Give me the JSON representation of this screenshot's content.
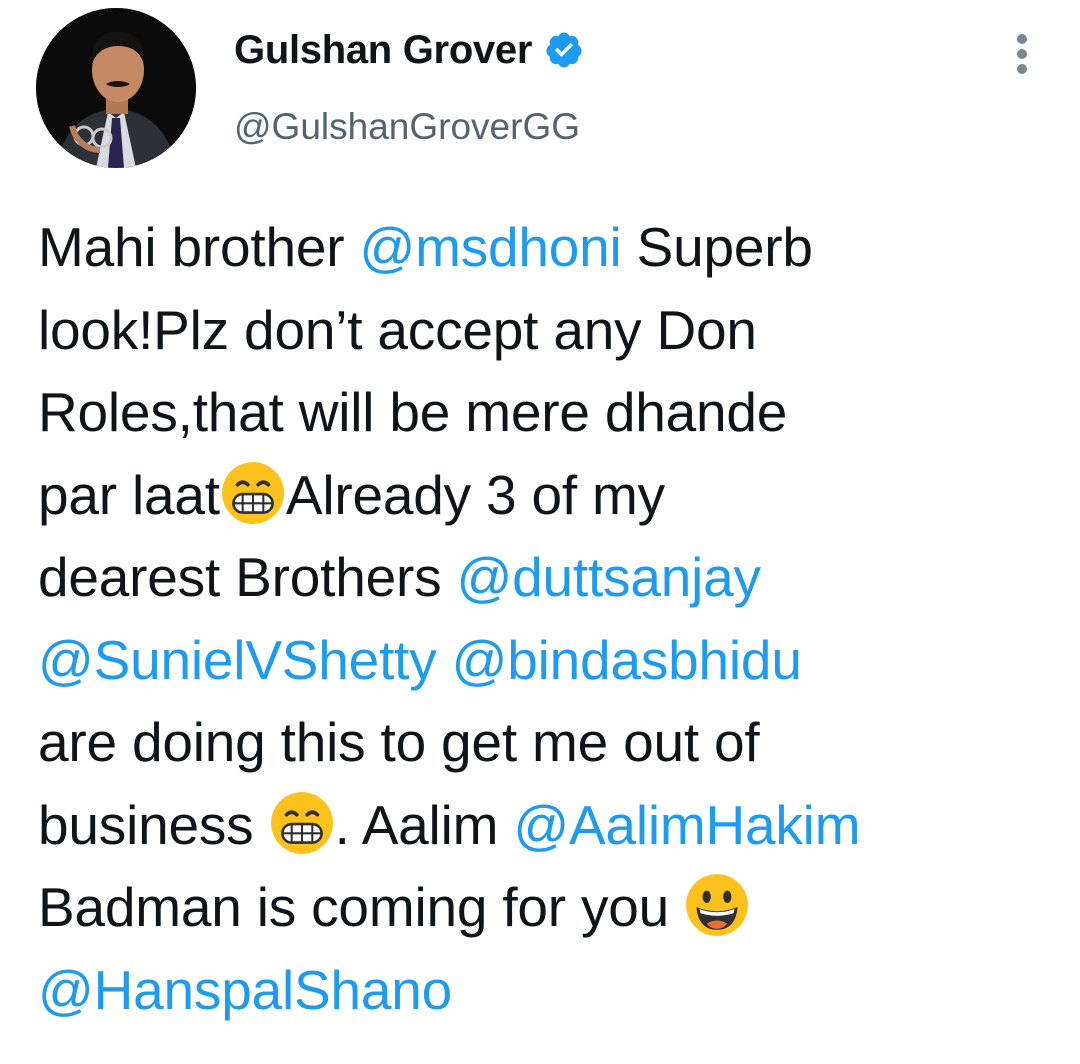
{
  "author": {
    "display_name": "Gulshan Grover",
    "handle": "@GulshanGroverGG",
    "verified": true,
    "avatar_icon": "profile-photo"
  },
  "menu_icon": "more-vertical-icon",
  "colors": {
    "mention": "#1d9bf0",
    "text": "#0f1419",
    "secondary": "#536471",
    "verified_badge": "#1d9bf0"
  },
  "tweet": {
    "lines": [
      [
        {
          "t": "text",
          "v": "Mahi brother "
        },
        {
          "t": "mention",
          "v": "@msdhoni"
        },
        {
          "t": "text",
          "v": " Superb"
        }
      ],
      [
        {
          "t": "text",
          "v": "look!Plz don’t accept any Don"
        }
      ],
      [
        {
          "t": "text",
          "v": "Roles,that will be mere dhande"
        }
      ],
      [
        {
          "t": "text",
          "v": "par laat"
        },
        {
          "t": "emoji",
          "v": "grinning-teeth-emoji"
        },
        {
          "t": "text",
          "v": "Already 3 of my"
        }
      ],
      [
        {
          "t": "text",
          "v": "dearest Brothers "
        },
        {
          "t": "mention",
          "v": "@duttsanjay"
        }
      ],
      [
        {
          "t": "mention",
          "v": "@SunielVShetty"
        },
        {
          "t": "text",
          "v": " "
        },
        {
          "t": "mention",
          "v": "@bindasbhidu"
        }
      ],
      [
        {
          "t": "text",
          "v": "are doing this to get me out of"
        }
      ],
      [
        {
          "t": "text",
          "v": "business "
        },
        {
          "t": "emoji",
          "v": "grinning-teeth-emoji"
        },
        {
          "t": "text",
          "v": ". Aalim "
        },
        {
          "t": "mention",
          "v": "@AalimHakim"
        }
      ],
      [
        {
          "t": "text",
          "v": "Badman is coming for you "
        },
        {
          "t": "emoji",
          "v": "grinning-face-emoji"
        }
      ],
      [
        {
          "t": "mention",
          "v": "@HanspalShano"
        }
      ]
    ]
  }
}
